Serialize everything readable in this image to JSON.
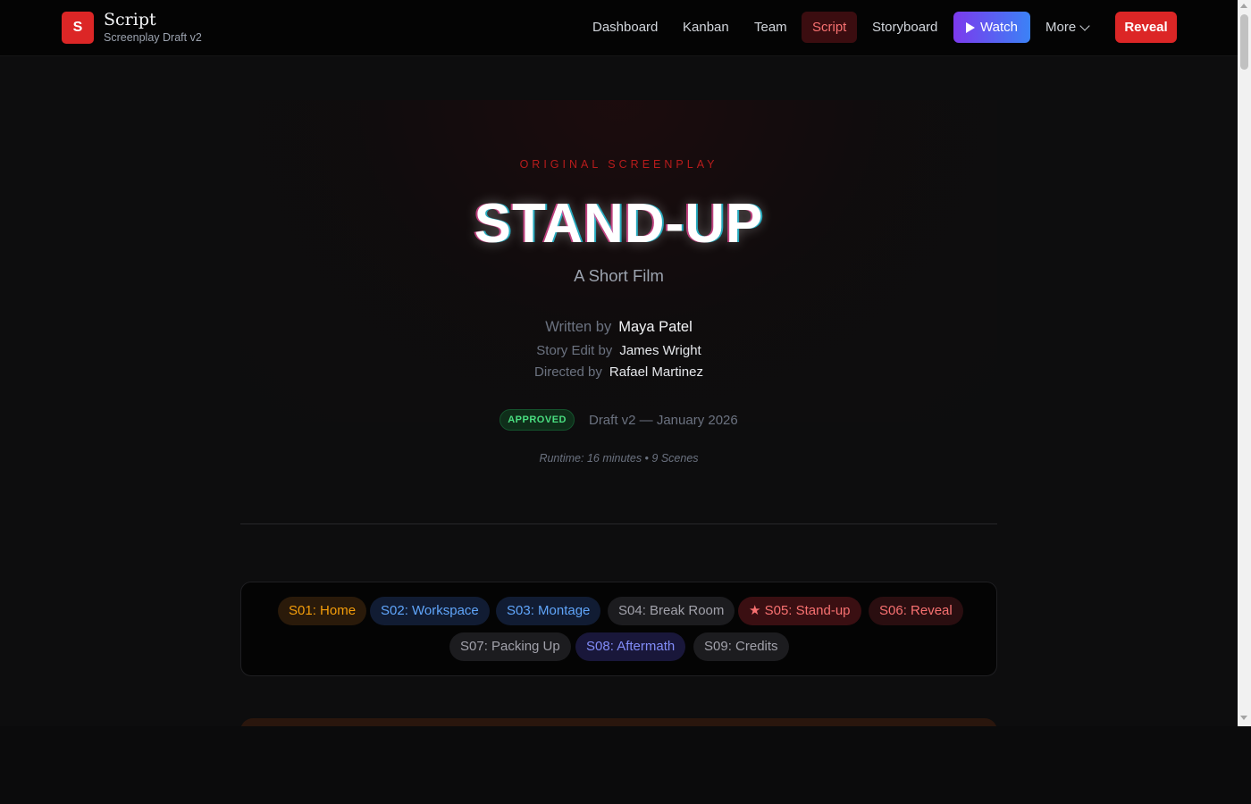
{
  "brand": {
    "logo_letter": "S",
    "title": "Script",
    "subtitle": "Screenplay Draft v2"
  },
  "nav": {
    "items": [
      {
        "label": "Dashboard"
      },
      {
        "label": "Kanban"
      },
      {
        "label": "Team"
      },
      {
        "label": "Script",
        "active": true
      },
      {
        "label": "Storyboard"
      }
    ],
    "watch_label": "Watch",
    "more_label": "More",
    "reveal_label": "Reveal"
  },
  "title_page": {
    "eyebrow": "ORIGINAL SCREENPLAY",
    "title": "STAND-UP",
    "subtitle": "A Short Film",
    "credits": [
      {
        "label": "Written by",
        "name": "Maya Patel"
      },
      {
        "label": "Story Edit by",
        "name": "James Wright"
      },
      {
        "label": "Directed by",
        "name": "Rafael Martinez"
      }
    ],
    "status_badge": "APPROVED",
    "draft_info": "Draft v2 — January 2026",
    "runtime": "Runtime: 16 minutes • 9 Scenes"
  },
  "scenes": [
    {
      "label": "S01: Home",
      "color": "amber"
    },
    {
      "label": "S02: Workspace",
      "color": "blue"
    },
    {
      "label": "S03: Montage",
      "color": "blue"
    },
    {
      "label": "S04: Break Room",
      "color": "gray"
    },
    {
      "label": "★ S05: Stand-up",
      "color": "red",
      "current": true
    },
    {
      "label": "S06: Reveal",
      "color": "red"
    },
    {
      "label": "S07: Packing Up",
      "color": "gray"
    },
    {
      "label": "S08: Aftermath",
      "color": "indigo"
    },
    {
      "label": "S09: Credits",
      "color": "gray"
    }
  ],
  "colors": {
    "accent_red": "#dc2626",
    "watch_gradient_start": "#7c3aed",
    "watch_gradient_end": "#3b82f6",
    "approved_green": "#4ade80"
  }
}
